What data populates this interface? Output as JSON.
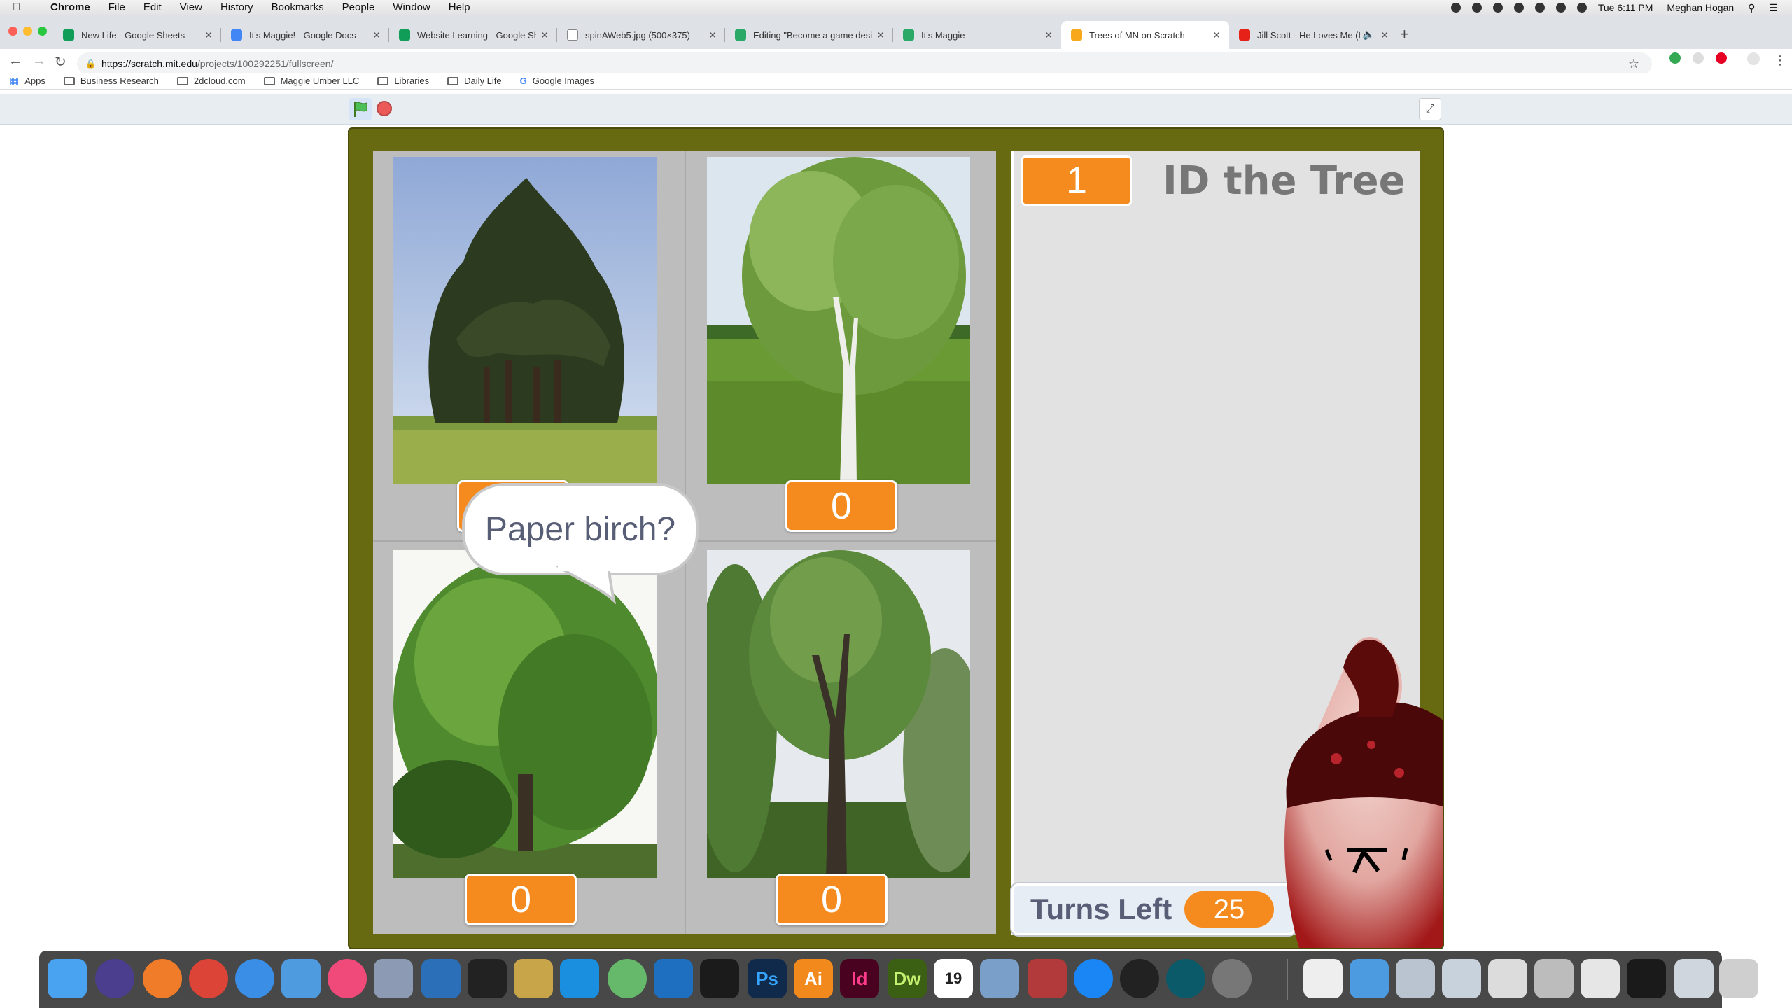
{
  "menubar": {
    "app": "Chrome",
    "items": [
      "File",
      "Edit",
      "View",
      "History",
      "Bookmarks",
      "People",
      "Window",
      "Help"
    ],
    "clock": "Tue 6:11 PM",
    "user": "Meghan Hogan"
  },
  "tabs": [
    {
      "label": "New Life - Google Sheets",
      "favicon_color": "#0f9d58"
    },
    {
      "label": "It's Maggie! - Google Docs",
      "favicon_color": "#4285f4"
    },
    {
      "label": "Website Learning - Google Sheets",
      "favicon_color": "#0f9d58"
    },
    {
      "label": "spinAWeb5.jpg (500×375)",
      "favicon_color": "#9e9e9e"
    },
    {
      "label": "Editing \"Become a game designer\"",
      "favicon_color": "#2aa865"
    },
    {
      "label": "It's Maggie",
      "favicon_color": "#2aa865"
    },
    {
      "label": "Trees of MN on Scratch",
      "favicon_color": "#f7a81b",
      "active": true
    },
    {
      "label": "Jill Scott - He Loves Me (Lo",
      "favicon_color": "#e62117"
    }
  ],
  "address": {
    "host": "https://scratch.mit.edu",
    "path": "/projects/100292251/fullscreen/"
  },
  "bookmarks": {
    "apps": "Apps",
    "items": [
      "Business Research",
      "2dcloud.com",
      "Maggie Umber LLC",
      "Libraries",
      "Daily Life",
      "Google Images"
    ]
  },
  "game": {
    "title": "ID the Tree",
    "round": "1",
    "speech": "Paper birch?",
    "turns_label": "Turns Left",
    "turns_left": "25",
    "scores": [
      "0",
      "0",
      "0",
      "0"
    ],
    "tree_images": [
      "white-pine-tree-photo",
      "paper-birch-tree-photo",
      "bur-oak-tree-photo",
      "elm-tree-photo"
    ]
  },
  "colors": {
    "stage_border": "#686a11",
    "score_orange": "#f58a1f",
    "panel_gray": "#e2e2e2"
  }
}
